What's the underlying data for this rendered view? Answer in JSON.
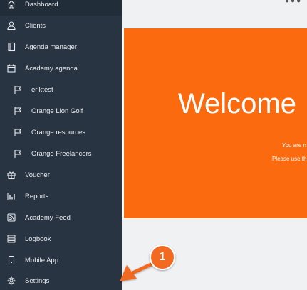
{
  "sidebar": {
    "items": [
      {
        "label": "Dashboard",
        "icon": "home-icon",
        "level": "top"
      },
      {
        "label": "Clients",
        "icon": "user-icon",
        "level": "top"
      },
      {
        "label": "Agenda manager",
        "icon": "book-icon",
        "level": "top"
      },
      {
        "label": "Academy agenda",
        "icon": "calendar-icon",
        "level": "top"
      },
      {
        "label": "eriktest",
        "icon": "flag-icon",
        "level": "sub"
      },
      {
        "label": "Orange Lion Golf",
        "icon": "flag-icon",
        "level": "sub"
      },
      {
        "label": "Orange resources",
        "icon": "flag-icon",
        "level": "sub"
      },
      {
        "label": "Orange Freelancers",
        "icon": "flag-icon",
        "level": "sub"
      },
      {
        "label": "Voucher",
        "icon": "gift-icon",
        "level": "top"
      },
      {
        "label": "Reports",
        "icon": "bar-chart-icon",
        "level": "top"
      },
      {
        "label": "Academy Feed",
        "icon": "rss-icon",
        "level": "top"
      },
      {
        "label": "Logbook",
        "icon": "list-icon",
        "level": "top"
      },
      {
        "label": "Mobile App",
        "icon": "mobile-icon",
        "level": "top"
      },
      {
        "label": "Settings",
        "icon": "gear-icon",
        "level": "top"
      }
    ]
  },
  "main": {
    "welcome_title": "Welcome",
    "line1": "You are n",
    "line2": "Please use th"
  },
  "callout": {
    "number": "1"
  },
  "colors": {
    "sidebar_bg": "#283442",
    "accent_orange": "#fb6a0f",
    "callout_orange": "#f26b21"
  }
}
